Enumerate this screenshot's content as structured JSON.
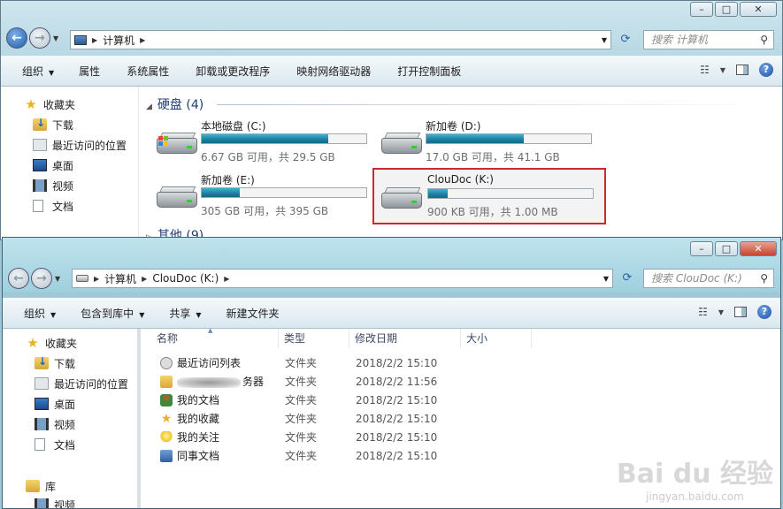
{
  "win1": {
    "address": {
      "seg1": "计算机"
    },
    "search_placeholder": "搜索 计算机",
    "toolbar": [
      "组织",
      "属性",
      "系统属性",
      "卸载或更改程序",
      "映射网络驱动器",
      "打开控制面板"
    ],
    "organize_caret": "▼",
    "sidebar": {
      "favorites": "收藏夹",
      "items": [
        "下载",
        "最近访问的位置",
        "桌面",
        "视频",
        "文档"
      ]
    },
    "section_harddisk": "硬盘 (4)",
    "section_other": "其他 (9)",
    "drives": [
      {
        "name": "本地磁盘 (C:)",
        "info": "6.67 GB 可用，共 29.5 GB",
        "used_fraction": 0.77
      },
      {
        "name": "新加卷 (D:)",
        "info": "17.0 GB 可用，共 41.1 GB",
        "used_fraction": 0.59
      },
      {
        "name": "新加卷 (E:)",
        "info": "305 GB 可用，共 395 GB",
        "used_fraction": 0.23
      },
      {
        "name": "ClouDoc (K:)",
        "info": "900 KB 可用，共 1.00 MB",
        "used_fraction": 0.12
      }
    ]
  },
  "win2": {
    "address": {
      "seg1": "计算机",
      "seg2": "ClouDoc (K:)"
    },
    "search_placeholder": "搜索 ClouDoc (K:)",
    "toolbar": [
      "组织",
      "包含到库中",
      "共享",
      "新建文件夹"
    ],
    "sidebar": {
      "favorites": "收藏夹",
      "items": [
        "下载",
        "最近访问的位置",
        "桌面",
        "视频",
        "文档"
      ],
      "library": "库",
      "lib_items": [
        "视频"
      ]
    },
    "columns": [
      "名称",
      "类型",
      "修改日期",
      "大小"
    ],
    "files": [
      {
        "name": "最近访问列表",
        "type": "文件夹",
        "date": "2018/2/2 15:10",
        "icon": "clock-icon"
      },
      {
        "name": "务器",
        "type": "文件夹",
        "date": "2018/2/2 11:56",
        "icon": "folder-icon"
      },
      {
        "name": "我的文档",
        "type": "文件夹",
        "date": "2018/2/2 15:10",
        "icon": "person-icon"
      },
      {
        "name": "我的收藏",
        "type": "文件夹",
        "date": "2018/2/2 15:10",
        "icon": "star-icon"
      },
      {
        "name": "我的关注",
        "type": "文件夹",
        "date": "2018/2/2 15:10",
        "icon": "bulb-icon"
      },
      {
        "name": "同事文档",
        "type": "文件夹",
        "date": "2018/2/2 15:10",
        "icon": "people-icon"
      }
    ]
  },
  "watermark": {
    "main": "Bai du 经验",
    "sub": "jingyan.baidu.com"
  },
  "colors": {
    "selection_border": "#cc2a2a",
    "bar_fill": "#1f7fa0"
  }
}
